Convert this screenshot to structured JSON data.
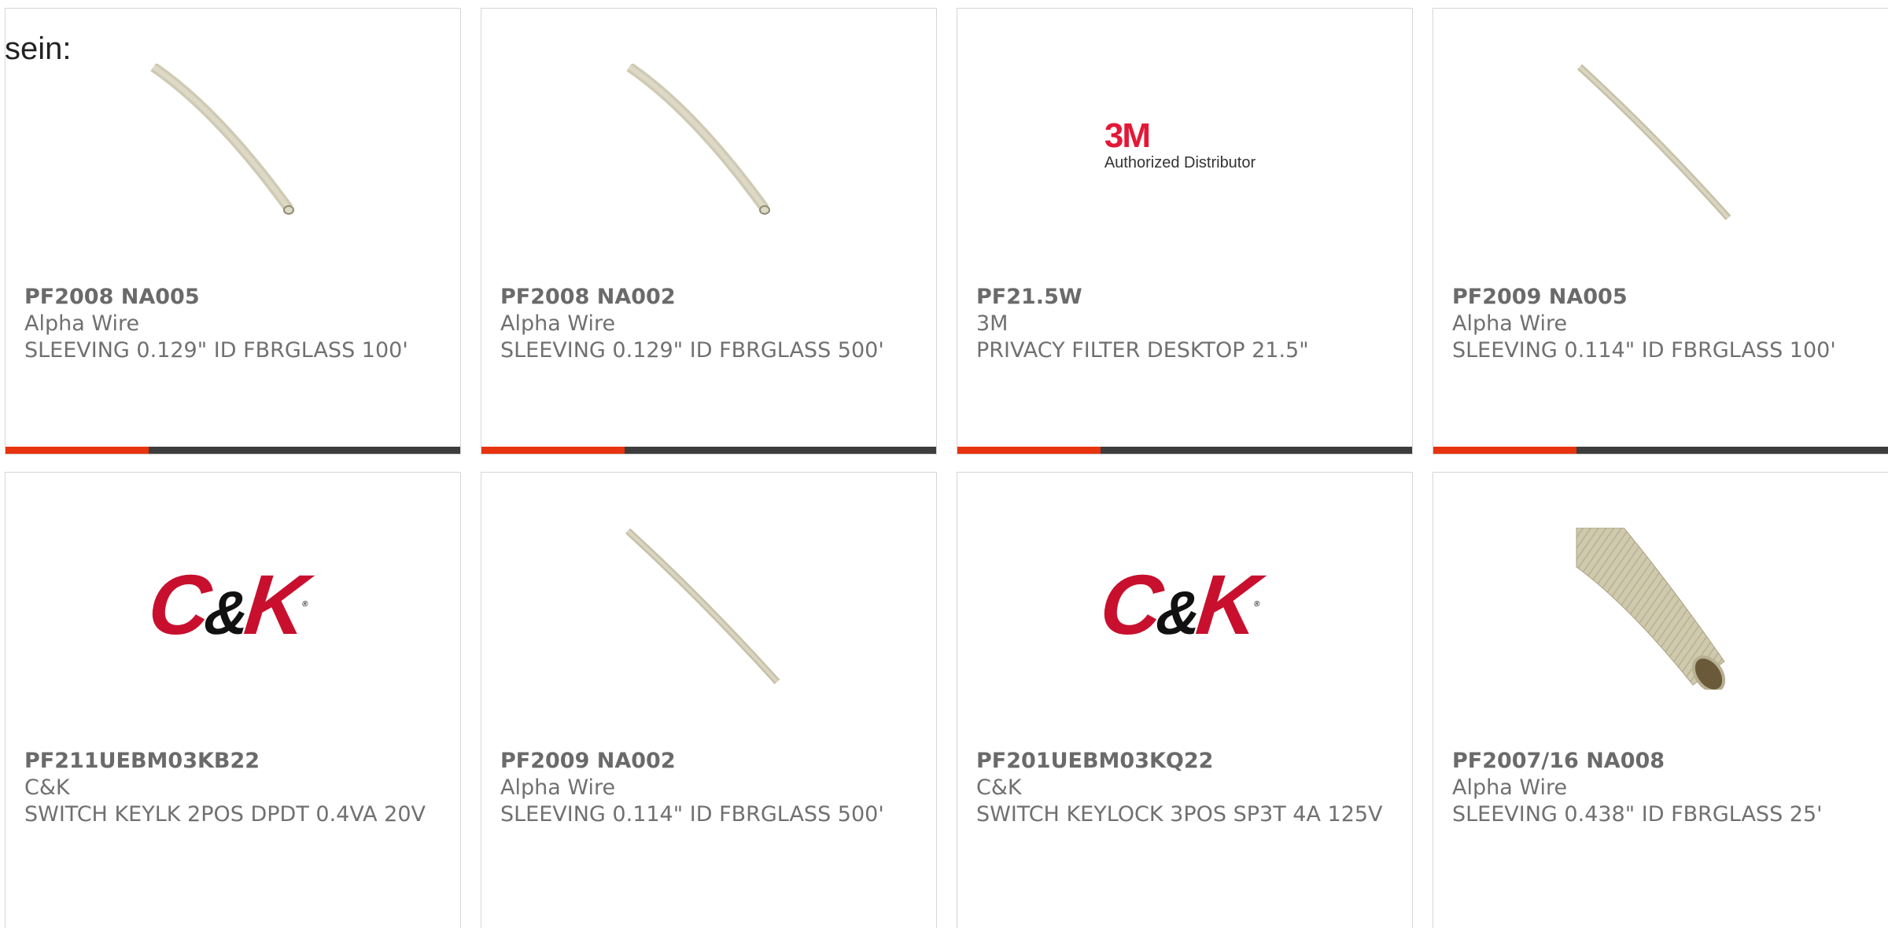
{
  "page": {
    "fragment_text": "sein:"
  },
  "brand": {
    "accent": "#e8330f",
    "bar": "#3d3d3d",
    "ck_red": "#c8102e",
    "m3_red": "#e31837"
  },
  "logos": {
    "m3": {
      "mark": "3M",
      "sub": "Authorized Distributor"
    },
    "ck": {
      "c": "C",
      "amp": "&",
      "k": "K",
      "tm": "®"
    }
  },
  "products": [
    {
      "part": "PF2008 NA005",
      "mfr": "Alpha Wire",
      "desc": "SLEEVING 0.129\" ID FBRGLASS 100'",
      "image": "thin-tube-image"
    },
    {
      "part": "PF2008 NA002",
      "mfr": "Alpha Wire",
      "desc": "SLEEVING 0.129\" ID FBRGLASS 500'",
      "image": "thin-tube-image"
    },
    {
      "part": "PF21.5W",
      "mfr": "3M",
      "desc": "PRIVACY FILTER DESKTOP 21.5\"",
      "image": "3m-authorized-distributor-logo"
    },
    {
      "part": "PF2009 NA005",
      "mfr": "Alpha Wire",
      "desc": "SLEEVING 0.114\" ID FBRGLASS 100'",
      "image": "thin-tube-image"
    },
    {
      "part": "PF211UEBM03KB22",
      "mfr": "C&K",
      "desc": "SWITCH KEYLK 2POS DPDT 0.4VA 20V",
      "image": "ck-logo"
    },
    {
      "part": "PF2009 NA002",
      "mfr": "Alpha Wire",
      "desc": "SLEEVING 0.114\" ID FBRGLASS 500'",
      "image": "thin-tube-image"
    },
    {
      "part": "PF201UEBM03KQ22",
      "mfr": "C&K",
      "desc": "SWITCH KEYLOCK 3POS SP3T 4A 125V",
      "image": "ck-logo"
    },
    {
      "part": "PF2007/16 NA008",
      "mfr": "Alpha Wire",
      "desc": "SLEEVING 0.438\" ID FBRGLASS 25'",
      "image": "thick-braided-tube-image"
    }
  ]
}
